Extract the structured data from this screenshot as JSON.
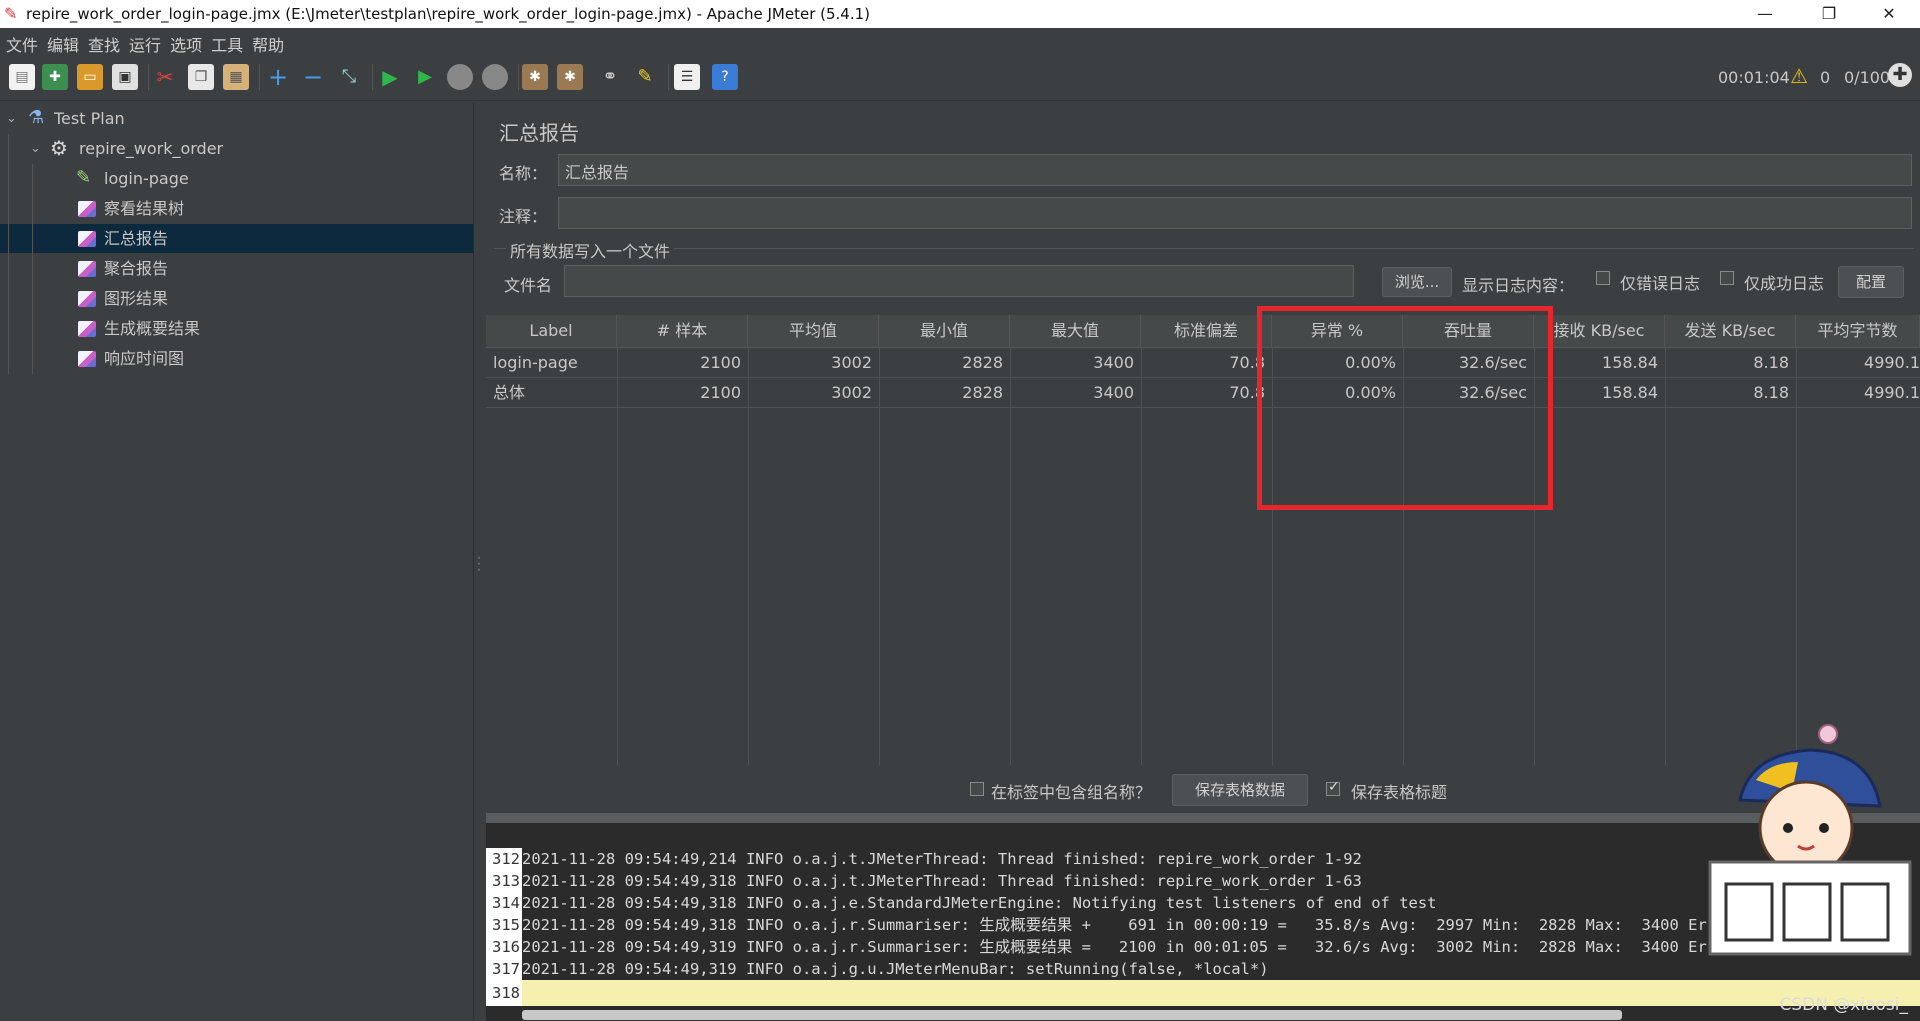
{
  "window": {
    "title": "repire_work_order_login-page.jmx (E:\\Jmeter\\testplan\\repire_work_order_login-page.jmx) - Apache JMeter (5.4.1)",
    "minimize": "—",
    "restore": "❐",
    "close": "✕"
  },
  "menu": [
    "文件",
    "编辑",
    "查找",
    "运行",
    "选项",
    "工具",
    "帮助"
  ],
  "toolbar": {
    "elapsed": "00:01:04",
    "warnings": "0",
    "threads": "0/100"
  },
  "tree": {
    "nodes": [
      {
        "label": "Test Plan",
        "icon": "flask-icon"
      },
      {
        "label": "repire_work_order",
        "icon": "gear-icon"
      },
      {
        "label": "login-page",
        "icon": "pipette-icon"
      },
      {
        "label": "察看结果树",
        "icon": "listener-icon"
      },
      {
        "label": "汇总报告",
        "icon": "listener-icon"
      },
      {
        "label": "聚合报告",
        "icon": "listener-icon"
      },
      {
        "label": "图形结果",
        "icon": "listener-icon"
      },
      {
        "label": "生成概要结果",
        "icon": "listener-icon"
      },
      {
        "label": "响应时间图",
        "icon": "listener-icon"
      }
    ]
  },
  "panel": {
    "title": "汇总报告",
    "name_label": "名称：",
    "name_value": "汇总报告",
    "comment_label": "注释：",
    "comment_value": "",
    "file_section": "所有数据写入一个文件",
    "filename_label": "文件名",
    "filename_value": "",
    "browse": "浏览...",
    "log_content_label": "显示日志内容：",
    "errors_only": "仅错误日志",
    "success_only": "仅成功日志",
    "configure": "配置"
  },
  "table": {
    "headers": [
      "Label",
      "# 样本",
      "平均值",
      "最小值",
      "最大值",
      "标准偏差",
      "异常 %",
      "吞吐量",
      "接收 KB/sec",
      "发送 KB/sec",
      "平均字节数"
    ],
    "rows": [
      [
        "login-page",
        "2100",
        "3002",
        "2828",
        "3400",
        "70.8",
        "0.00%",
        "32.6/sec",
        "158.84",
        "8.18",
        "4990.1"
      ],
      [
        "总体",
        "2100",
        "3002",
        "2828",
        "3400",
        "70.8",
        "0.00%",
        "32.6/sec",
        "158.84",
        "8.18",
        "4990.1"
      ]
    ]
  },
  "bottom": {
    "include_group": "在标签中包含组名称？",
    "save_table_data": "保存表格数据",
    "save_header": "保存表格标题"
  },
  "log": {
    "lines": [
      {
        "n": "312",
        "text": "2021-11-28 09:54:49,214 INFO o.a.j.t.JMeterThread: Thread finished: repire_work_order 1-92"
      },
      {
        "n": "313",
        "text": "2021-11-28 09:54:49,318 INFO o.a.j.t.JMeterThread: Thread finished: repire_work_order 1-63"
      },
      {
        "n": "314",
        "text": "2021-11-28 09:54:49,318 INFO o.a.j.e.StandardJMeterEngine: Notifying test listeners of end of test"
      },
      {
        "n": "315",
        "text": "2021-11-28 09:54:49,318 INFO o.a.j.r.Summariser: 生成概要结果 +    691 in 00:00:19 =   35.8/s Avg:  2997 Min:  2828 Max:  3400 Err:     0 (0"
      },
      {
        "n": "316",
        "text": "2021-11-28 09:54:49,319 INFO o.a.j.r.Summariser: 生成概要结果 =   2100 in 00:01:05 =   32.6/s Avg:  3002 Min:  2828 Max:  3400 Err:     0 (0"
      },
      {
        "n": "317",
        "text": "2021-11-28 09:54:49,319 INFO o.a.j.g.u.JMeterMenuBar: setRunning(false, *local*)"
      },
      {
        "n": "318",
        "text": ""
      }
    ]
  },
  "watermark": "CSDN @xiaosi_"
}
